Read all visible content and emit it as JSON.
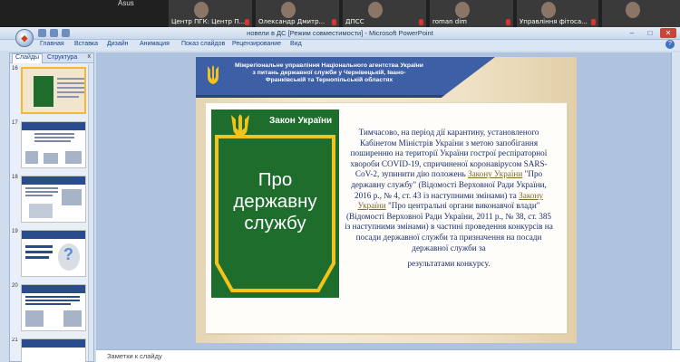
{
  "video_conference": {
    "device_label": "Asus",
    "participants": [
      {
        "name": "Центр ПГК: Центр П..."
      },
      {
        "name": "Олександр Дмитр..."
      },
      {
        "name": "ДПСС"
      },
      {
        "name": "roman dim"
      },
      {
        "name": "Управління фітоса..."
      }
    ]
  },
  "window": {
    "title": "новели в ДС [Режим совместимости] - Microsoft PowerPoint",
    "controls": [
      "–",
      "□",
      "✕"
    ],
    "office_button_icon": "office-logo"
  },
  "ribbon": {
    "tabs": [
      "Главная",
      "Вставка",
      "Дизайн",
      "Анимация",
      "Показ слайдов",
      "Рецензирование",
      "Вид"
    ],
    "help_label": "?"
  },
  "left_panel": {
    "tabs": [
      "Слайды",
      "Структура"
    ],
    "close_label": "x",
    "thumbnails": [
      {
        "number": "16",
        "selected": true
      },
      {
        "number": "17",
        "selected": false
      },
      {
        "number": "18",
        "selected": false
      },
      {
        "number": "19",
        "selected": false
      },
      {
        "number": "20",
        "selected": false
      },
      {
        "number": "21",
        "selected": false
      }
    ]
  },
  "slide": {
    "header": "Міжрегіональне управління Національного агентства України з питань державної служби у Чернівецькій, Івано-Франківській та Тернопільській областях",
    "book_law": "Закон України",
    "book_main": "Про державну службу",
    "body_part1": "Тимчасово, на період дії карантину, установленого Кабінетом Міністрів України з метою запобігання поширенню на території України гострої респіраторної хвороби COVID-19, спричиненої коронавірусом SARS-CoV-2, зупинити дію положень ",
    "body_link1": "Закону України",
    "body_part2": " \"Про державну службу\" (Відомості Верховної Ради України, 2016 р., № 4, ст. 43 із наступними змінами) та ",
    "body_link2": "Закону України",
    "body_part3": " \"Про центральні органи виконавчої влади\" (Відомості Верховної Ради України, 2011 р., № 38, ст. 385 із наступними змінами) в частині проведення конкурсів на посади державної служби та призначення на посади державної служби за",
    "body_last": "результатами конкурсу."
  },
  "notes": {
    "label": "Заметки к слайду"
  },
  "colors": {
    "header_blue": "#3c5fa6",
    "book_green": "#1f6d2d",
    "trident_gold": "#f3c31b",
    "body_text": "#1c2e6b"
  }
}
